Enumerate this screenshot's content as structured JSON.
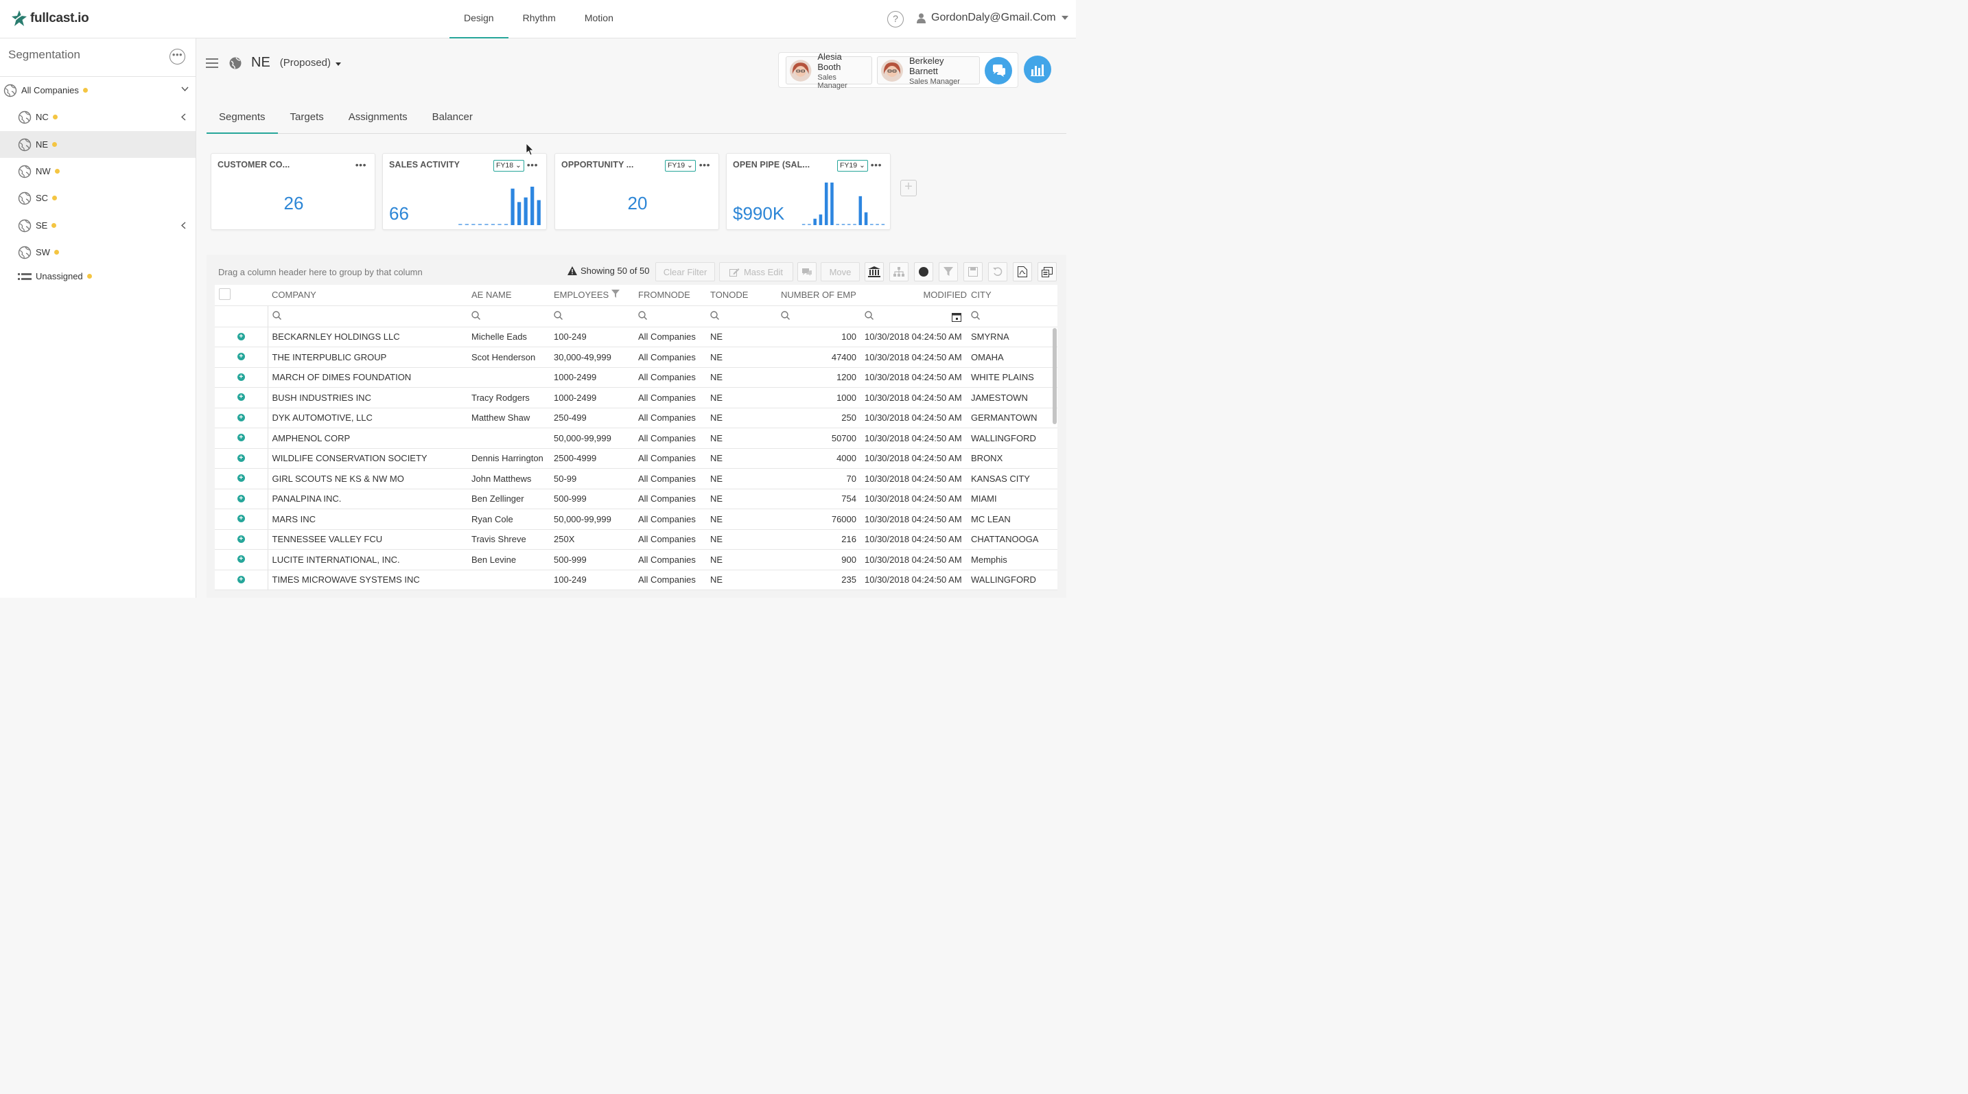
{
  "app": {
    "logo_text": "fullcast.io"
  },
  "topnav": {
    "items": [
      "Design",
      "Rhythm",
      "Motion"
    ],
    "active": "Design"
  },
  "user": {
    "email": "GordonDaly@Gmail.Com",
    "help": "?"
  },
  "sidebar": {
    "title": "Segmentation",
    "root": {
      "label": "All Companies"
    },
    "items": [
      {
        "label": "NC"
      },
      {
        "label": "NE"
      },
      {
        "label": "NW"
      },
      {
        "label": "SC"
      },
      {
        "label": "SE"
      },
      {
        "label": "SW"
      },
      {
        "label": "Unassigned"
      }
    ],
    "selected": "NE",
    "status_color": "#f4c542"
  },
  "header": {
    "region": "NE",
    "status": "(Proposed)"
  },
  "team": [
    {
      "name": "Alesia Booth",
      "role": "Sales Manager"
    },
    {
      "name": "Berkeley Barnett",
      "role": "Sales Manager"
    }
  ],
  "tabs": [
    "Segments",
    "Targets",
    "Assignments",
    "Balancer"
  ],
  "cards": [
    {
      "title": "CUSTOMER CO...",
      "value": "26"
    },
    {
      "title": "SALES ACTIVITY",
      "fy": "FY18",
      "value": "66",
      "bars": [
        0,
        0,
        0,
        0,
        0,
        0,
        0,
        0,
        0.95,
        0.6,
        0.72,
        1.0,
        0.65
      ]
    },
    {
      "title": "OPPORTUNITY ...",
      "fy": "FY19",
      "value": "20"
    },
    {
      "title": "OPEN PIPE (SAL...",
      "fy": "FY19",
      "value": "$990K",
      "bars": [
        0,
        0,
        0.15,
        0.25,
        1.0,
        1.0,
        0,
        0,
        0,
        0,
        0.68,
        0.3,
        0,
        0,
        0
      ]
    }
  ],
  "grid": {
    "group_hint": "Drag a column header here to group by that column",
    "showing": "Showing 50 of 50",
    "buttons": {
      "clear_filter": "Clear Filter",
      "mass_edit": "Mass Edit",
      "move": "Move"
    },
    "columns": [
      "COMPANY",
      "AE NAME",
      "EMPLOYEES",
      "FROMNODE",
      "TONODE",
      "NUMBER OF EMP",
      "MODIFIED",
      "CITY"
    ],
    "rows": [
      [
        "BECKARNLEY HOLDINGS LLC",
        "Michelle Eads",
        "100-249",
        "All Companies",
        "NE",
        "100",
        "10/30/2018 04:24:50 AM",
        "SMYRNA"
      ],
      [
        "THE INTERPUBLIC GROUP",
        "Scot Henderson",
        "30,000-49,999",
        "All Companies",
        "NE",
        "47400",
        "10/30/2018 04:24:50 AM",
        "OMAHA"
      ],
      [
        "MARCH OF DIMES FOUNDATION",
        "",
        "1000-2499",
        "All Companies",
        "NE",
        "1200",
        "10/30/2018 04:24:50 AM",
        "WHITE PLAINS"
      ],
      [
        "BUSH INDUSTRIES INC",
        "Tracy Rodgers",
        "1000-2499",
        "All Companies",
        "NE",
        "1000",
        "10/30/2018 04:24:50 AM",
        "JAMESTOWN"
      ],
      [
        "DYK AUTOMOTIVE, LLC",
        "Matthew Shaw",
        "250-499",
        "All Companies",
        "NE",
        "250",
        "10/30/2018 04:24:50 AM",
        "GERMANTOWN"
      ],
      [
        "AMPHENOL CORP",
        "",
        "50,000-99,999",
        "All Companies",
        "NE",
        "50700",
        "10/30/2018 04:24:50 AM",
        "WALLINGFORD"
      ],
      [
        "WILDLIFE CONSERVATION SOCIETY",
        "Dennis Harrington",
        "2500-4999",
        "All Companies",
        "NE",
        "4000",
        "10/30/2018 04:24:50 AM",
        "BRONX"
      ],
      [
        "GIRL SCOUTS NE KS & NW MO",
        "John Matthews",
        "50-99",
        "All Companies",
        "NE",
        "70",
        "10/30/2018 04:24:50 AM",
        "KANSAS CITY"
      ],
      [
        "PANALPINA INC.",
        "Ben Zellinger",
        "500-999",
        "All Companies",
        "NE",
        "754",
        "10/30/2018 04:24:50 AM",
        "MIAMI"
      ],
      [
        "MARS INC",
        "Ryan Cole",
        "50,000-99,999",
        "All Companies",
        "NE",
        "76000",
        "10/30/2018 04:24:50 AM",
        "MC LEAN"
      ],
      [
        "TENNESSEE VALLEY FCU",
        "Travis Shreve",
        "250X",
        "All Companies",
        "NE",
        "216",
        "10/30/2018 04:24:50 AM",
        "CHATTANOOGA"
      ],
      [
        "LUCITE INTERNATIONAL, INC.",
        "Ben Levine",
        "500-999",
        "All Companies",
        "NE",
        "900",
        "10/30/2018 04:24:50 AM",
        "Memphis"
      ],
      [
        "TIMES MICROWAVE SYSTEMS INC",
        "",
        "100-249",
        "All Companies",
        "NE",
        "235",
        "10/30/2018 04:24:50 AM",
        "WALLINGFORD"
      ]
    ]
  },
  "colors": {
    "accent": "#26a69a",
    "value_blue": "#2d86d6",
    "bar_blue": "#2d86e0",
    "chat_blue": "#42a5e8"
  }
}
